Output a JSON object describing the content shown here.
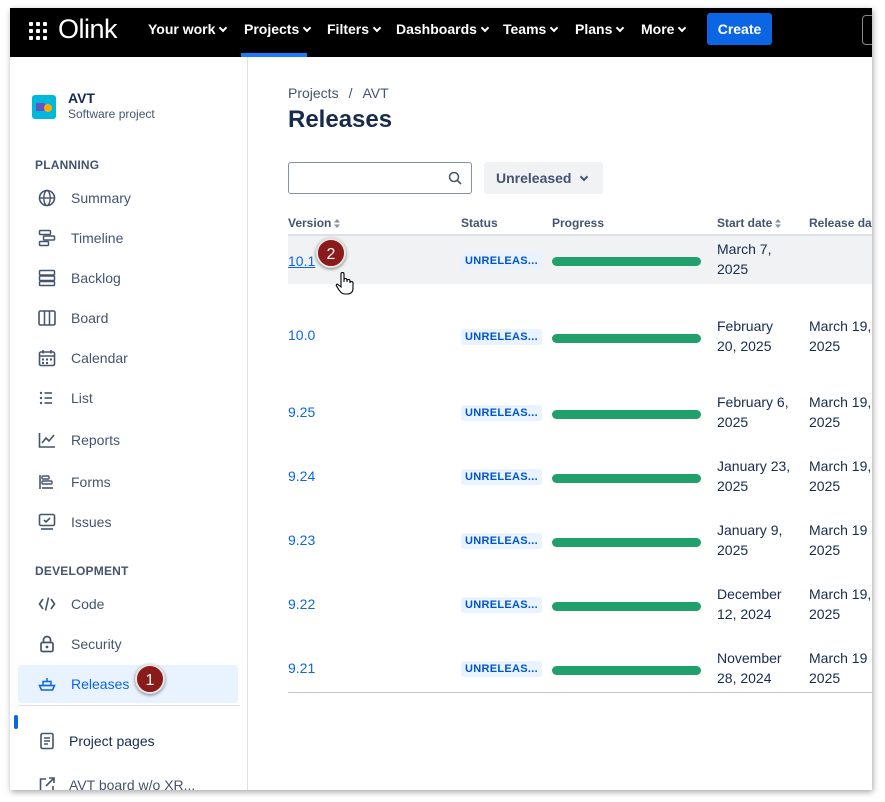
{
  "topnav": {
    "logo": "Olink",
    "items": [
      {
        "label": "Your work",
        "has_menu": true
      },
      {
        "label": "Projects",
        "has_menu": true,
        "active": true
      },
      {
        "label": "Filters",
        "has_menu": true
      },
      {
        "label": "Dashboards",
        "has_menu": true
      },
      {
        "label": "Teams",
        "has_menu": true
      },
      {
        "label": "Plans",
        "has_menu": true
      },
      {
        "label": "More",
        "has_menu": true
      }
    ],
    "create_label": "Create",
    "active_color": "#1d7afc",
    "create_color": "#0c66e4"
  },
  "sidebar": {
    "project_name": "AVT",
    "project_type": "Software project",
    "planning_heading": "PLANNING",
    "planning_items": [
      {
        "label": "Summary",
        "icon": "globe-icon"
      },
      {
        "label": "Timeline",
        "icon": "timeline-icon"
      },
      {
        "label": "Backlog",
        "icon": "backlog-icon"
      },
      {
        "label": "Board",
        "icon": "board-icon"
      },
      {
        "label": "Calendar",
        "icon": "calendar-icon"
      },
      {
        "label": "List",
        "icon": "list-icon"
      },
      {
        "label": "Reports",
        "icon": "reports-icon"
      },
      {
        "label": "Forms",
        "icon": "forms-icon"
      },
      {
        "label": "Issues",
        "icon": "issues-icon"
      }
    ],
    "development_heading": "DEVELOPMENT",
    "development_items": [
      {
        "label": "Code",
        "icon": "code-icon"
      },
      {
        "label": "Security",
        "icon": "lock-icon"
      },
      {
        "label": "Releases",
        "icon": "ship-icon",
        "active": true
      }
    ],
    "extra_items": [
      {
        "label": "Project pages",
        "icon": "page-icon"
      },
      {
        "label": "AVT board w/o XR...",
        "icon": "external-link-icon"
      }
    ]
  },
  "main": {
    "breadcrumb": [
      "Projects",
      "AVT"
    ],
    "title": "Releases",
    "search": {
      "value": "",
      "placeholder": ""
    },
    "filter_label": "Unreleased",
    "columns": [
      "Version",
      "Status",
      "Progress",
      "Start date",
      "Release date"
    ],
    "rows": [
      {
        "version": "10.1",
        "status": "UNRELEAS...",
        "start_line1": "March 7,",
        "start_line2": "2025",
        "release_line1": "",
        "release_line2": "",
        "progress": 1.0,
        "hover": true
      },
      {
        "version": "10.0",
        "status": "UNRELEAS...",
        "start_line1": "February",
        "start_line2": "20, 2025",
        "release_line1": "March 19,",
        "release_line2": "2025",
        "progress": 1.0
      },
      {
        "version": "9.25",
        "status": "UNRELEAS...",
        "start_line1": "February 6,",
        "start_line2": "2025",
        "release_line1": "March 19,",
        "release_line2": "2025",
        "progress": 1.0
      },
      {
        "version": "9.24",
        "status": "UNRELEAS...",
        "start_line1": "January 23,",
        "start_line2": "2025",
        "release_line1": "March 19,",
        "release_line2": "2025",
        "progress": 1.0
      },
      {
        "version": "9.23",
        "status": "UNRELEAS...",
        "start_line1": "January 9,",
        "start_line2": "2025",
        "release_line1": "March 19",
        "release_line2": "2025",
        "progress": 1.0
      },
      {
        "version": "9.22",
        "status": "UNRELEAS...",
        "start_line1": "December",
        "start_line2": "12, 2024",
        "release_line1": "March 19,",
        "release_line2": "2025",
        "progress": 1.0
      },
      {
        "version": "9.21",
        "status": "UNRELEAS...",
        "start_line1": "November",
        "start_line2": "28, 2024",
        "release_line1": "March 19",
        "release_line2": "2025",
        "progress": 1.0
      }
    ],
    "progress_color": "#22a06b",
    "status_color": "#0055cc"
  },
  "callouts": [
    "1",
    "2"
  ]
}
